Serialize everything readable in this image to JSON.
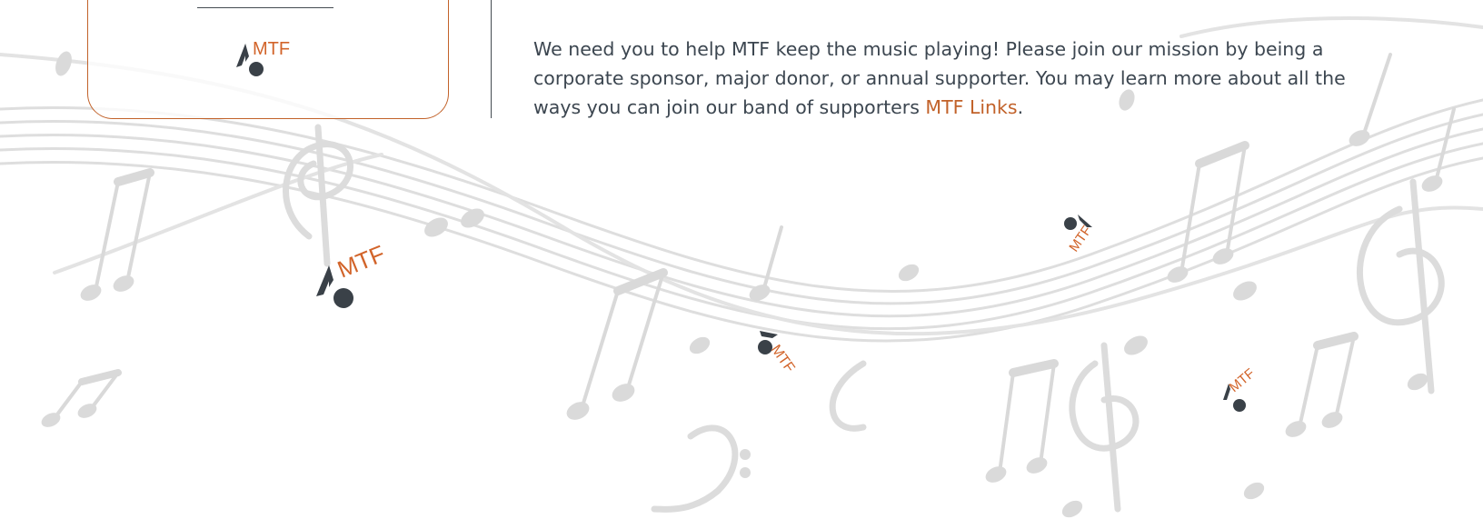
{
  "brand": {
    "logo_text": "MTF",
    "accent_color": "#c2622a",
    "logo_note_color": "#3a4148",
    "text_color": "#3c4650"
  },
  "support": {
    "paragraph_lead": "We need you to help MTF keep the music playing!  Please join our mission by being a corporate sponsor, major donor, or annual supporter.  You may learn more about all the ways you can join our band of supporters ",
    "link_label": "MTF Links",
    "paragraph_end": "."
  },
  "decor": {
    "background": "music-staff-and-notes",
    "logo_icon": "music-note-icon"
  }
}
